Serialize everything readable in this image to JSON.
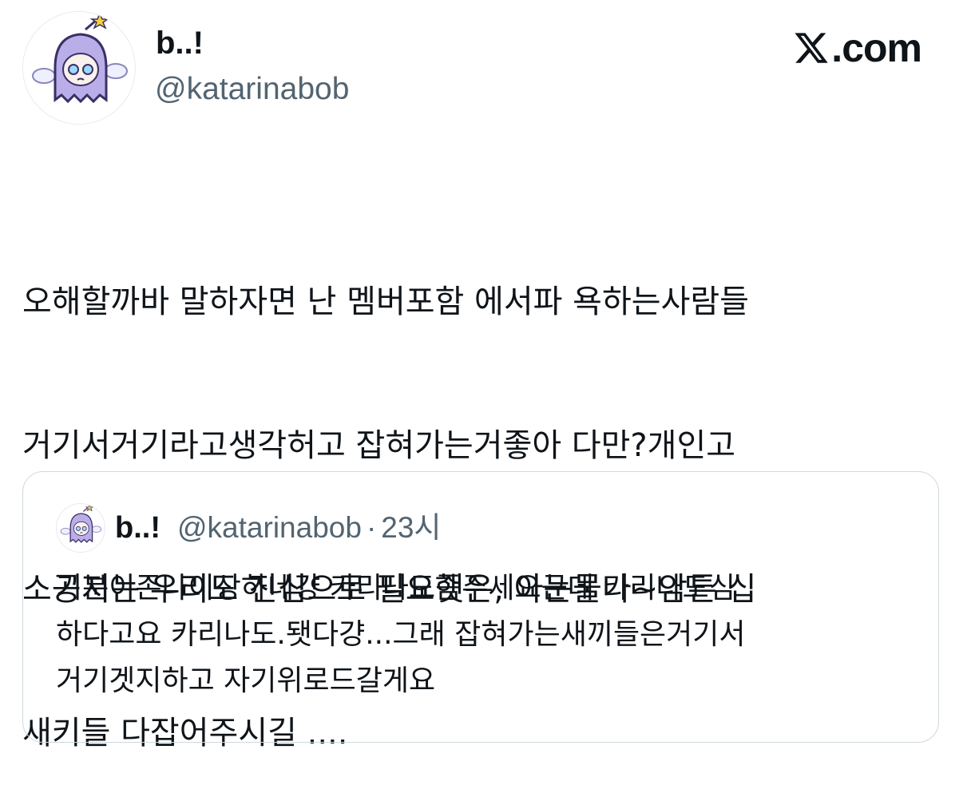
{
  "author": {
    "display_name": "b..!",
    "handle": "@katarinabob",
    "avatar_icon": "pixel-ghost-avatar-icon"
  },
  "brand": {
    "icon": "x-logo-icon",
    "label": ".com"
  },
  "tweet": {
    "lines": [
      "오해할까바 말하자면 난 멤버포함 에서파 욕하는사람들",
      "거기서거기라고생각허고 잡혀가는거좋아 다만?개인고",
      "소공지는 우리도 진심으로 필요햇은, 아눈물나~암튼 십",
      "새키들 다잡어주시길 ...."
    ]
  },
  "quoted_tweet": {
    "display_name": "b..!",
    "handle": "@katarinabob",
    "separator": "·",
    "time": "23시",
    "lines": [
      "기분이존나이상하네걍 카리나도좀주세요근데 카리나도심",
      "하다고요 카리나도.됏다걍...그래 잡혀가는새끼들은거기서",
      "거기겟지하고 자기위로드갈게요"
    ]
  },
  "colors": {
    "text": "#0f1419",
    "secondary": "#536471",
    "border": "#cfd9de",
    "avatar_purple": "#b9aee8"
  }
}
